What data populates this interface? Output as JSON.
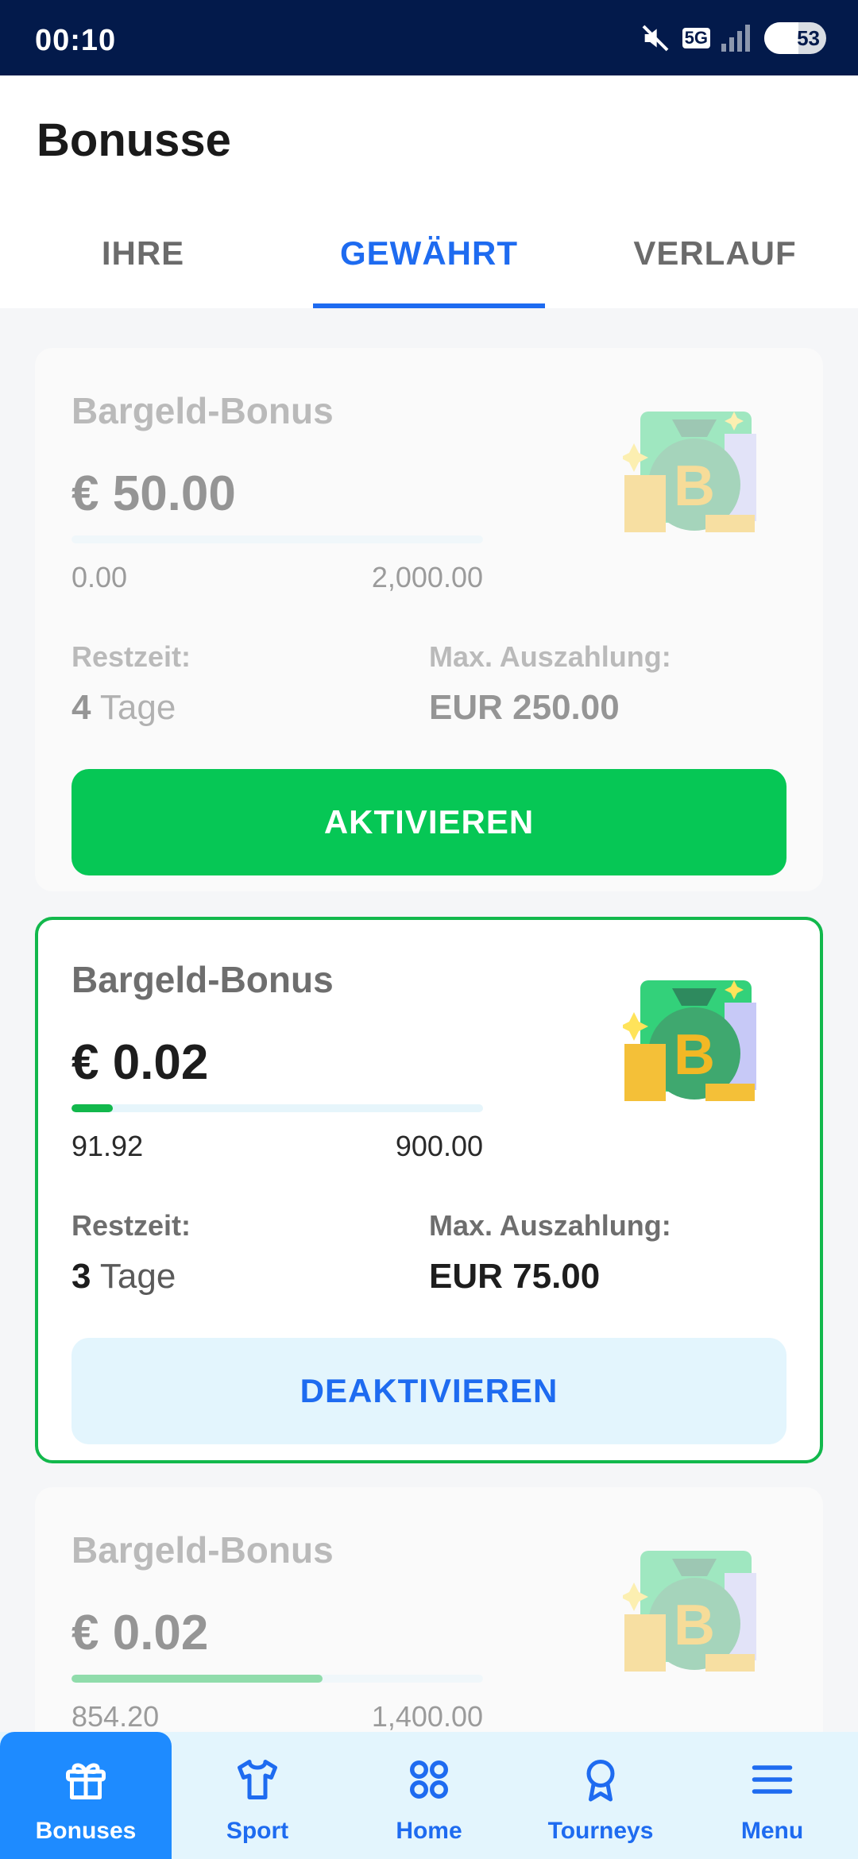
{
  "status_bar": {
    "time": "00:10",
    "battery": "53",
    "network": "5G"
  },
  "header": {
    "title": "Bonusse"
  },
  "tabs": [
    {
      "label": "IHRE"
    },
    {
      "label": "GEWÄHRT"
    },
    {
      "label": "VERLAUF"
    }
  ],
  "cards": [
    {
      "title": "Bargeld-Bonus",
      "amount": "€ 50.00",
      "progress_min": "0.00",
      "progress_max": "2,000.00",
      "progress_fraction": 0.0,
      "remaining_label": "Restzeit:",
      "remaining_number": "4",
      "remaining_unit": "Tage",
      "payout_label": "Max. Auszahlung:",
      "payout_value": "EUR 250.00",
      "button_label": "AKTIVIEREN",
      "icon": "money-bag-icon"
    },
    {
      "title": "Bargeld-Bonus",
      "amount": "€ 0.02",
      "progress_min": "91.92",
      "progress_max": "900.00",
      "progress_fraction": 0.1,
      "remaining_label": "Restzeit:",
      "remaining_number": "3",
      "remaining_unit": "Tage",
      "payout_label": "Max. Auszahlung:",
      "payout_value": "EUR 75.00",
      "button_label": "DEAKTIVIEREN",
      "icon": "money-bag-icon"
    },
    {
      "title": "Bargeld-Bonus",
      "amount": "€ 0.02",
      "progress_min": "854.20",
      "progress_max": "1,400.00",
      "progress_fraction": 0.61,
      "icon": "money-bag-icon"
    }
  ],
  "bottom_nav": [
    {
      "label": "Bonuses",
      "icon": "gift-icon"
    },
    {
      "label": "Sport",
      "icon": "shirt-icon"
    },
    {
      "label": "Home",
      "icon": "grid-icon"
    },
    {
      "label": "Tourneys",
      "icon": "award-icon"
    },
    {
      "label": "Menu",
      "icon": "menu-icon"
    }
  ],
  "colors": {
    "brand_blue": "#1e6bf0",
    "active_green": "#12b84c",
    "button_green": "#06c755",
    "status_bar": "#031a4b"
  }
}
